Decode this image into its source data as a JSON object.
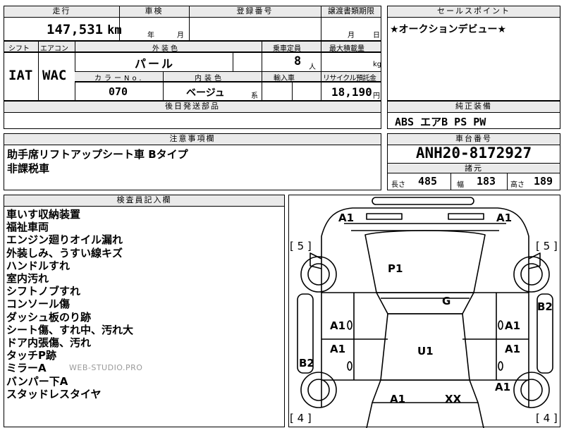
{
  "header": {
    "mileage_label": "走行",
    "inspection_label": "車検",
    "registration_label": "登録番号",
    "transfer_deadline_label": "譲渡書類期限",
    "sales_point_label": "セールスポイント"
  },
  "mileage": {
    "value": "147,531",
    "unit": "km"
  },
  "inspection": {
    "year_unit": "年",
    "month_unit": "月"
  },
  "transfer": {
    "month_unit": "月",
    "day_unit": "日"
  },
  "sales_point": {
    "text": "★オークションデビュー★"
  },
  "row2": {
    "shift_label": "シフト",
    "aircon_label": "エアコン",
    "exterior_label": "外装色",
    "capacity_label": "乗車定員",
    "maxload_label": "最大積載量",
    "shift_value": "IAT",
    "aircon_value": "WAC",
    "exterior_value": "パール",
    "capacity_value": "8",
    "capacity_unit": "人",
    "maxload_unit": "kg"
  },
  "row3": {
    "color_no_label": "カラーNo.",
    "interior_label": "内装色",
    "import_label": "輸入車",
    "recycle_label": "リサイクル預託金",
    "color_no_value": "070",
    "interior_value": "ベージュ",
    "interior_suffix": "系",
    "recycle_value": "18,190",
    "recycle_unit": "円"
  },
  "later_parts": {
    "label": "後日発送部品"
  },
  "equipment": {
    "label": "純正装備",
    "value": "ABS エアB PS PW"
  },
  "notes": {
    "label": "注意事項欄",
    "lines": [
      "助手席リフトアップシート車 Bタイプ",
      "非課税車"
    ]
  },
  "chassis": {
    "label": "車台番号",
    "value": "ANH20-8172927",
    "spec_label": "諸元",
    "length_label": "長さ",
    "length_value": "485",
    "width_label": "幅",
    "width_value": "183",
    "height_label": "高さ",
    "height_value": "189"
  },
  "inspector": {
    "label": "検査員記入欄",
    "lines": [
      "車いす収納装置",
      "福祉車両",
      "エンジン廻りオイル漏れ",
      "外装しみ、うすい線キズ",
      "ハンドルすれ",
      "室内汚れ",
      "シフトノブすれ",
      "コンソール傷",
      "ダッシュ板のり跡",
      "シート傷、すれ中、汚れ大",
      "ドア内張傷、汚れ",
      "タッチP跡",
      "ミラーA",
      "バンパー下A",
      "スタッドレスタイヤ"
    ],
    "watermark": "WEB-STUDIO.PRO"
  },
  "diagram": {
    "front_left": "A1",
    "front_right": "A1",
    "tire_fl": "[ 5 ]",
    "tire_fr": "[ 5 ]",
    "hood": "P1",
    "windshield": "G",
    "right_side": "B2",
    "left_front_door": "A1",
    "right_front_door": "A1",
    "left_rear_door": "A1",
    "right_rear_door": "A1",
    "roof": "U1",
    "left_side": "B2",
    "right_quarter": "A1",
    "rear_left": "A1",
    "rear_center": "XX",
    "tire_rl": "[ 4 ]",
    "tire_rr": "[ 4 ]"
  }
}
